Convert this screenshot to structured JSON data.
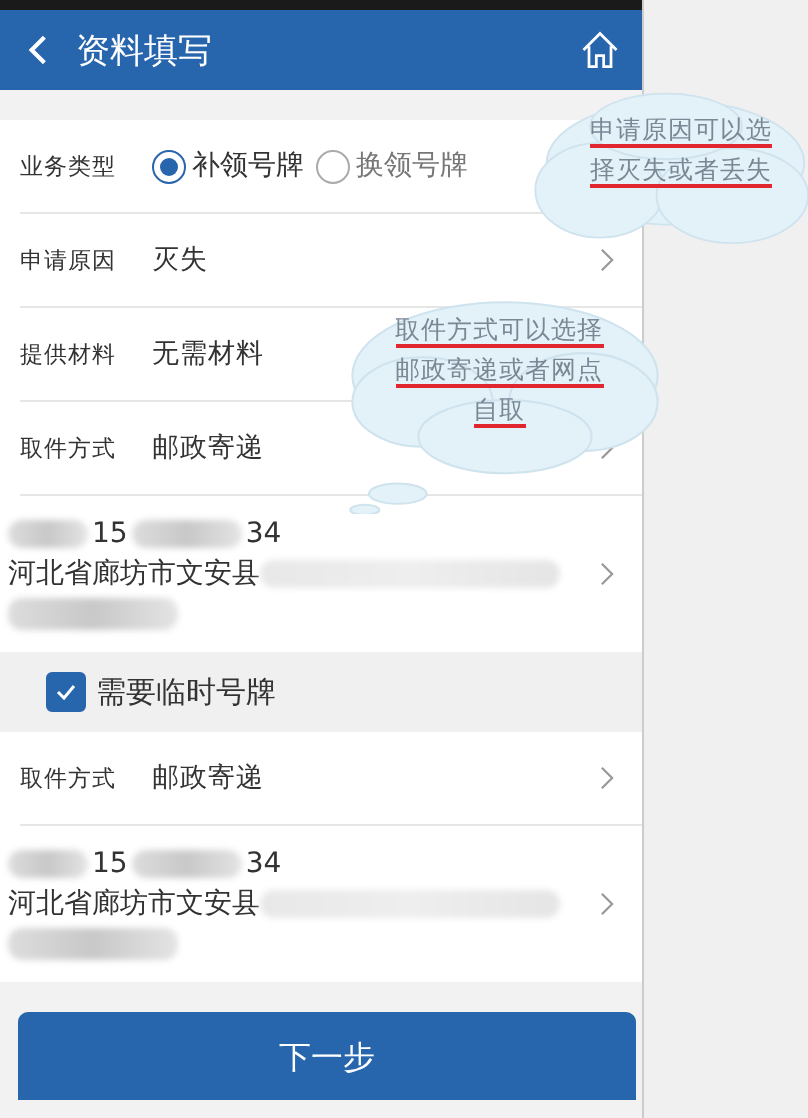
{
  "header": {
    "title": "资料填写"
  },
  "sections": [
    {
      "rows": [
        {
          "kind": "radio",
          "label": "业务类型",
          "options": [
            {
              "label": "补领号牌",
              "selected": true
            },
            {
              "label": "换领号牌",
              "selected": false
            }
          ]
        },
        {
          "kind": "select",
          "label": "申请原因",
          "value": "灭失",
          "chevron": true
        },
        {
          "kind": "select",
          "label": "提供材料",
          "value": "无需材料",
          "chevron": false
        },
        {
          "kind": "select",
          "label": "取件方式",
          "value": "邮政寄递",
          "chevron": true
        },
        {
          "kind": "address",
          "phone_start": "15",
          "phone_end": "34",
          "address": "河北省廊坊市文安县",
          "chevron": true
        }
      ]
    },
    {
      "checkbox": {
        "label": "需要临时号牌",
        "checked": true
      },
      "rows": [
        {
          "kind": "select",
          "label": "取件方式",
          "value": "邮政寄递",
          "chevron": true
        },
        {
          "kind": "address",
          "phone_start": "15",
          "phone_end": "34",
          "address": "河北省廊坊市文安县",
          "chevron": true
        }
      ]
    }
  ],
  "button": "下一步",
  "annotations": [
    {
      "lines": [
        "申请原因可以选",
        "择灭失或者丢失"
      ]
    },
    {
      "lines": [
        "取件方式可以选择",
        "邮政寄递或者网点",
        "自取"
      ]
    }
  ]
}
